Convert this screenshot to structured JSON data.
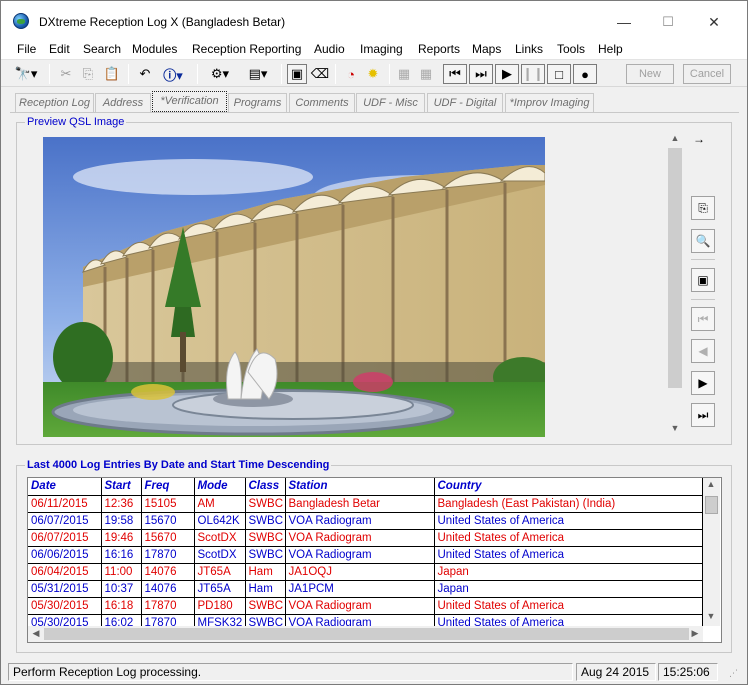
{
  "window": {
    "title": "DXtreme Reception Log X (Bangladesh Betar)",
    "minimize": "—",
    "maximize": "☐",
    "close": "✕"
  },
  "menu": [
    "File",
    "Edit",
    "Search",
    "Modules",
    "Reception Reporting",
    "Audio",
    "Imaging",
    "Reports",
    "Maps",
    "Links",
    "Tools",
    "Help"
  ],
  "toolbar": {
    "new_label": "New",
    "cancel_label": "Cancel"
  },
  "tabs": [
    "Reception Log",
    "Address",
    "*Verification",
    "Programs",
    "Comments",
    "UDF - Misc",
    "UDF - Digital",
    "*Improv Imaging"
  ],
  "active_tab_index": 2,
  "preview": {
    "group_label": "Preview QSL Image"
  },
  "log": {
    "group_label": "Last 4000 Log Entries By Date and Start Time Descending",
    "columns": [
      "Date",
      "Start",
      "Freq",
      "Mode",
      "Class",
      "Station",
      "Country"
    ],
    "rows": [
      {
        "color": "red",
        "cells": [
          "06/11/2015",
          "12:36",
          "15105",
          "AM",
          "SWBC",
          "Bangladesh Betar",
          "Bangladesh (East Pakistan) (India)"
        ]
      },
      {
        "color": "blue",
        "cells": [
          "06/07/2015",
          "19:58",
          "15670",
          "OL642K",
          "SWBC",
          "VOA Radiogram",
          "United States of America"
        ]
      },
      {
        "color": "red",
        "cells": [
          "06/07/2015",
          "19:46",
          "15670",
          "ScotDX",
          "SWBC",
          "VOA Radiogram",
          "United States of America"
        ]
      },
      {
        "color": "blue",
        "cells": [
          "06/06/2015",
          "16:16",
          "17870",
          "ScotDX",
          "SWBC",
          "VOA Radiogram",
          "United States of America"
        ]
      },
      {
        "color": "red",
        "cells": [
          "06/04/2015",
          "11:00",
          "14076",
          "JT65A",
          "Ham",
          "JA1OQJ",
          "Japan"
        ]
      },
      {
        "color": "blue",
        "cells": [
          "05/31/2015",
          "10:37",
          "14076",
          "JT65A",
          "Ham",
          "JA1PCM",
          "Japan"
        ]
      },
      {
        "color": "red",
        "cells": [
          "05/30/2015",
          "16:18",
          "17870",
          "PD180",
          "SWBC",
          "VOA Radiogram",
          "United States of America"
        ]
      },
      {
        "color": "blue",
        "cells": [
          "05/30/2015",
          "16:02",
          "17870",
          "MFSK32",
          "SWBC",
          "VOA Radiogram",
          "United States of America"
        ]
      }
    ]
  },
  "status": {
    "message": "Perform Reception Log processing.",
    "date": "Aug 24 2015",
    "time": "15:25:06"
  },
  "colors": {
    "accent_blue": "#0000cc",
    "row_red": "#e00000"
  }
}
